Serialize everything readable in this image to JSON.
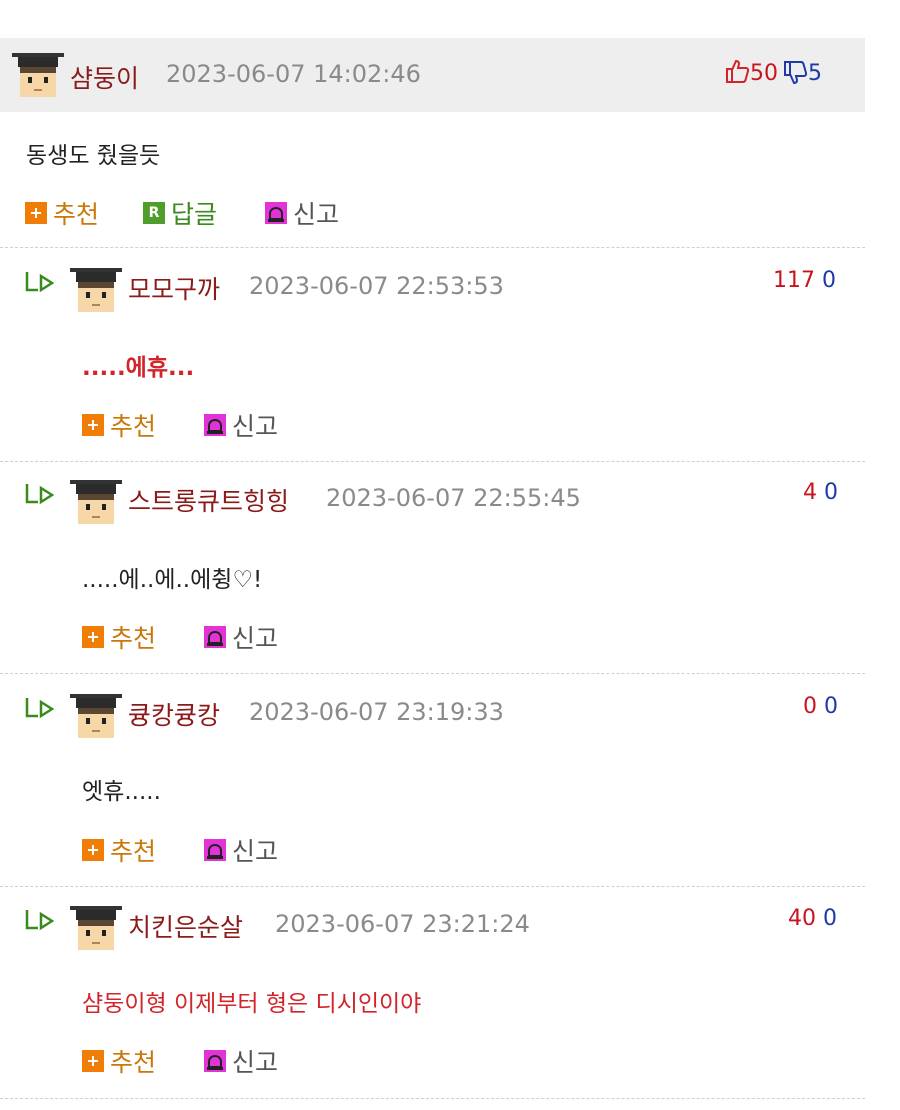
{
  "main": {
    "author": "샴둥이",
    "date": "2023-06-07 14:02:46",
    "up": "50",
    "down": "5",
    "text": "동생도 줬을듯",
    "actions": {
      "recommend": "추천",
      "reply": "답글",
      "report": "신고"
    },
    "icons": {
      "up": "thumbs-up-icon",
      "down": "thumbs-down-icon",
      "plus": "plus-icon",
      "reply": "reply-r-icon",
      "report": "siren-icon"
    }
  },
  "replies": [
    {
      "author": "모모구까",
      "date": "2023-06-07 22:53:53",
      "up": "117",
      "down": "0",
      "text": ".....에휴...",
      "style": "red-bold",
      "recommend": "추천",
      "report": "신고"
    },
    {
      "author": "스트롱큐트힝힝",
      "date": "2023-06-07 22:55:45",
      "up": "4",
      "down": "0",
      "text": ".....에..에..에췽♡!",
      "style": "normal",
      "recommend": "추천",
      "report": "신고"
    },
    {
      "author": "큥캉큥캉",
      "date": "2023-06-07 23:19:33",
      "up": "0",
      "down": "0",
      "text": "엣휴.....",
      "style": "normal",
      "recommend": "추천",
      "report": "신고"
    },
    {
      "author": "치킨은순살",
      "date": "2023-06-07 23:21:24",
      "up": "40",
      "down": "0",
      "text": "샴둥이형 이제부터 형은 디시인이야",
      "style": "red",
      "recommend": "추천",
      "report": "신고"
    }
  ],
  "colors": {
    "nick": "#8b1a1a",
    "up": "#c8141e",
    "down": "#1f3aa8",
    "recommend": "#c9780a",
    "reply": "#3a8a1f",
    "bg_head": "#eeeeee"
  }
}
